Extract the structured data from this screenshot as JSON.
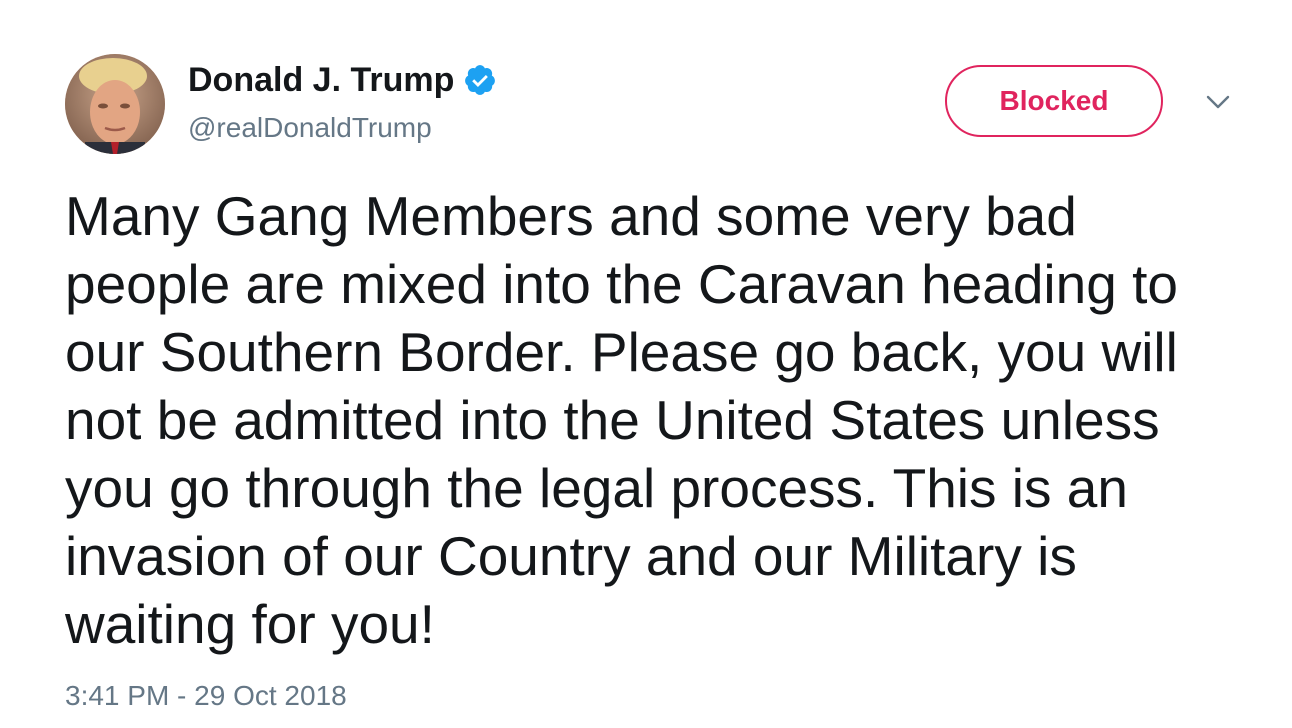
{
  "author": {
    "display_name": "Donald J. Trump",
    "handle": "@realDonaldTrump",
    "verified": true,
    "avatar_icon": "profile-photo"
  },
  "actions": {
    "blocked_label": "Blocked",
    "menu_icon": "chevron-down-icon"
  },
  "tweet": {
    "text": "Many Gang Members and some very bad\npeople are mixed into the Caravan heading to\nour Southern Border. Please go back, you will\nnot be admitted into the United States unless\nyou go through the legal process. This is an\ninvasion of our Country and our Military is\nwaiting for you!",
    "timestamp": "3:41 PM - 29 Oct 2018"
  },
  "colors": {
    "text": "#14171a",
    "secondary": "#657786",
    "verified_blue": "#1da1f2",
    "blocked_red": "#e0245e"
  }
}
